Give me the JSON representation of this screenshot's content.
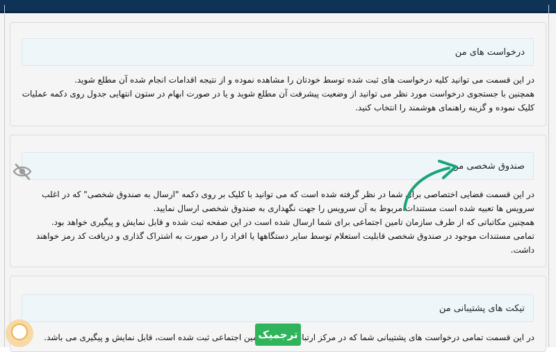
{
  "sections": [
    {
      "title": "درخواست های من",
      "paragraphs": [
        "در این قسمت می توانید کلیه درخواست های ثبت شده توسط خودتان را مشاهده نموده و از نتیجه اقدامات انجام شده آن مطلع شوید.",
        "همچنین با جستجوی درخواست مورد نظر می توانید از وضعیت پیشرفت آن مطلع شوید و یا در صورت ابهام در ستون انتهایی جدول روی دکمه عملیات کلیک نموده و گزینه راهنمای هوشمند را انتخاب کنید."
      ]
    },
    {
      "title": "صندوق شخصی من",
      "paragraphs": [
        "در این قسمت فضایی اختصاصی برای شما در نظر گرفته شده است که می توانید با کلیک بر روی دکمه \"ارسال به صندوق شخصی\" که در اغلب سرویس ها تعبیه شده است مستندات مربوط به آن سرویس را جهت نگهداری به صندوق شخصی ارسال نمایید.",
        "همچنین مکاتباتی که از طرف سازمان تامین اجتماعی برای شما ارسال شده است در این صفحه ثبت شده و قابل نمایش و پیگیری خواهد بود.",
        "تمامی مستندات موجود در صندوق شخصی قابلیت استعلام توسط سایر دستگاهها یا افراد را در صورت به اشتراک گذاری و دریافت کد رمز خواهند داشت."
      ]
    },
    {
      "title": "تیکت های پشتیبانی من",
      "paragraphs": [
        "در این قسمت تمامی درخواست های پشتیبانی شما که در مرکز ارتباط سازمان تامین اجتماعی ثبت شده است، قابل نمایش و پیگیری می باشد."
      ]
    }
  ],
  "overlay": {
    "badge_label": "ترجمیک",
    "icons": {
      "hidden": "eye-slash-icon",
      "arrow": "curved-arrow-icon",
      "avatar": "avatar-icon"
    },
    "colors": {
      "header_bar": "#0f3357",
      "badge": "#2fb35b",
      "arrow": "#1aa37a"
    }
  }
}
